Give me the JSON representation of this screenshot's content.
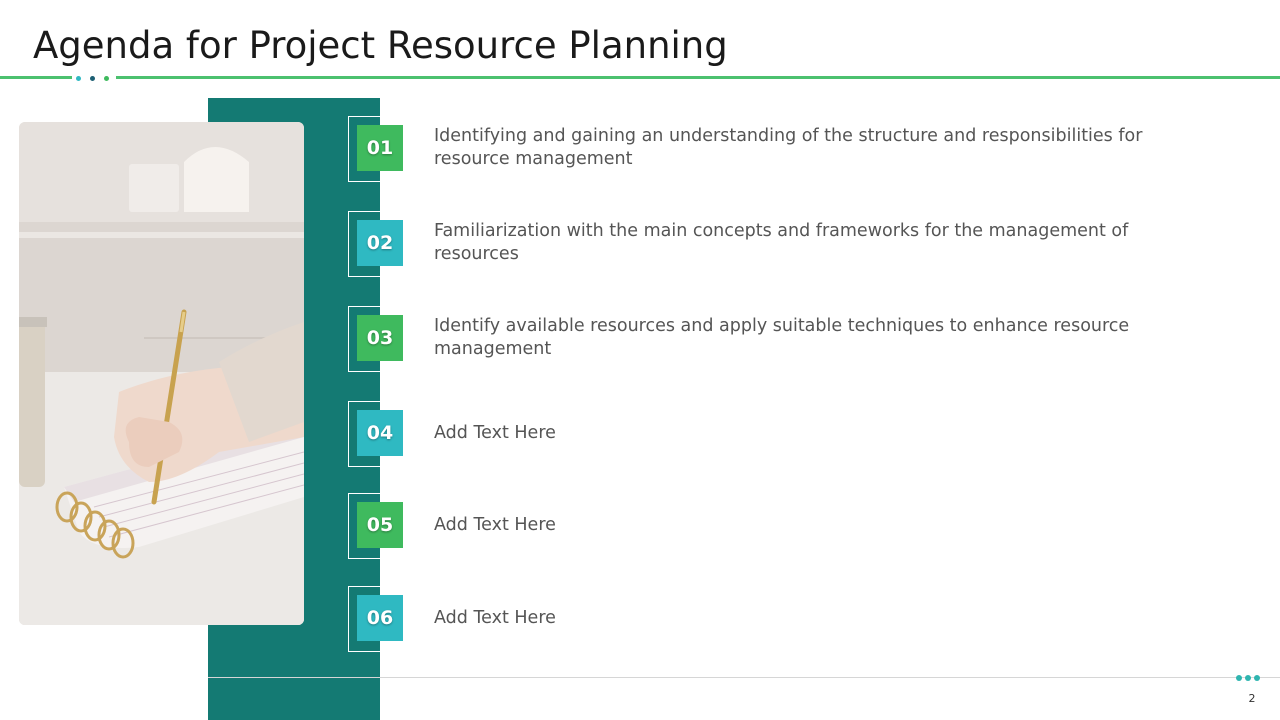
{
  "title": "Agenda for Project Resource Planning",
  "colors": {
    "accent_green": "#4cc16f",
    "teal_band": "#147a73",
    "num_green": "#3fba5e",
    "num_cyan": "#2fb9c2",
    "dot_dark": "#1d5f73"
  },
  "photo": {
    "icon": "notebook-writing-photo"
  },
  "items": [
    {
      "number": "01",
      "text": "Identifying and gaining an understanding of the structure and responsibilities  for resource management"
    },
    {
      "number": "02",
      "text": "Familiarization  with the main concepts and frameworks for the management of resources"
    },
    {
      "number": "03",
      "text": "Identify available resources and apply suitable techniques to enhance resource management"
    },
    {
      "number": "04",
      "text": "Add Text Here"
    },
    {
      "number": "05",
      "text": "Add Text Here"
    },
    {
      "number": "06",
      "text": "Add Text Here"
    }
  ],
  "page_number": "2"
}
